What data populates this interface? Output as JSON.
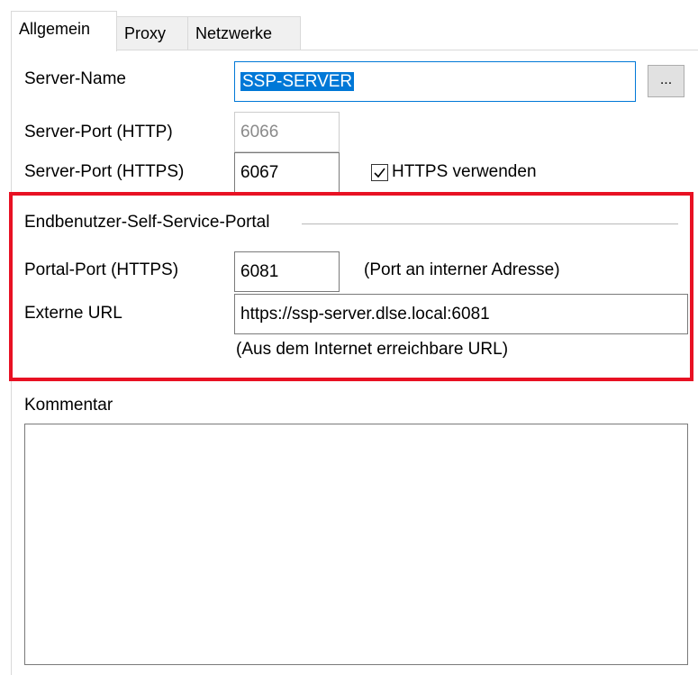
{
  "tabs": [
    {
      "label": "Allgemein",
      "active": true
    },
    {
      "label": "Proxy",
      "active": false
    },
    {
      "label": "Netzwerke",
      "active": false
    }
  ],
  "server": {
    "name_label": "Server-Name",
    "name_value": "SSP-SERVER",
    "browse_label": "...",
    "http_port_label": "Server-Port (HTTP)",
    "http_port_value": "6066",
    "https_port_label": "Server-Port (HTTPS)",
    "https_port_value": "6067",
    "use_https_label": "HTTPS verwenden",
    "use_https_checked": true
  },
  "portal": {
    "group_title": "Endbenutzer-Self-Service-Portal",
    "port_label": "Portal-Port (HTTPS)",
    "port_value": "6081",
    "port_hint": "(Port an interner Adresse)",
    "url_label": "Externe URL",
    "url_value": "https://ssp-server.dlse.local:6081",
    "url_hint": "(Aus dem Internet erreichbare URL)"
  },
  "comment": {
    "label": "Kommentar",
    "value": ""
  },
  "colors": {
    "highlight": "#e81123",
    "focus": "#0078d7",
    "selection": "#0078d7"
  }
}
